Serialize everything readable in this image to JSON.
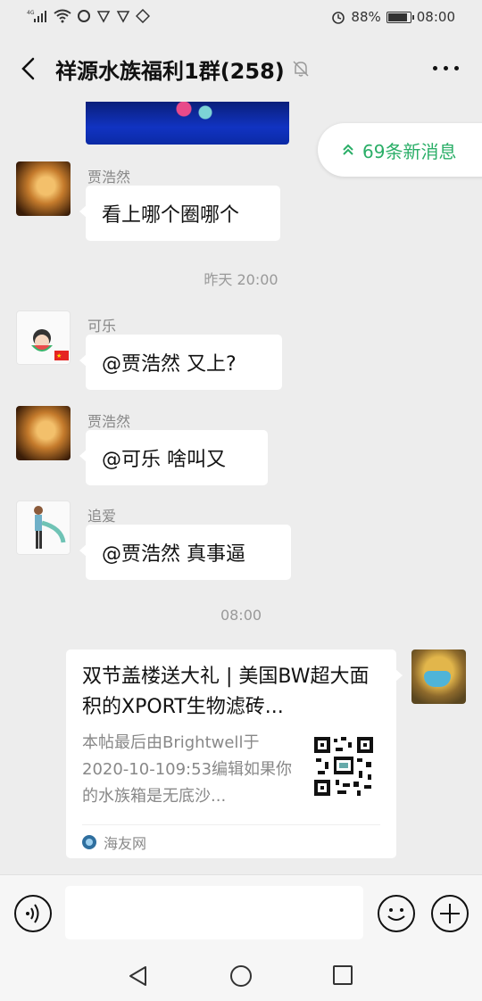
{
  "status_bar": {
    "left_icons": [
      "signal-4g-icon",
      "wifi-icon",
      "app-icon-1",
      "app-icon-2",
      "app-icon-3",
      "app-icon-4"
    ],
    "battery_percent": "88%",
    "battery_level": 0.88,
    "time": "08:00"
  },
  "header": {
    "title": "祥源水族福利1群(258)"
  },
  "new_messages": {
    "label": "69条新消息"
  },
  "messages": [
    {
      "sender": "贾浩然",
      "text": "看上哪个圈哪个"
    },
    {
      "sender": "可乐",
      "text": "@贾浩然  又上?"
    },
    {
      "sender": "贾浩然",
      "text": "@可乐  啥叫又"
    },
    {
      "sender": "追爱",
      "text": "@贾浩然  真事逼"
    }
  ],
  "timestamps": {
    "t1": "昨天 20:00",
    "t2": "08:00"
  },
  "link_card": {
    "title": "双节盖楼送大礼 | 美国BW超大面积的XPORT生物滤砖...",
    "description": "本帖最后由Brightwell于2020-10-109:53编辑如果你的水族箱是无底沙...",
    "source": "海友网"
  },
  "colors": {
    "accent_green": "#2aae67",
    "background": "#ededed",
    "bubble": "#ffffff"
  }
}
